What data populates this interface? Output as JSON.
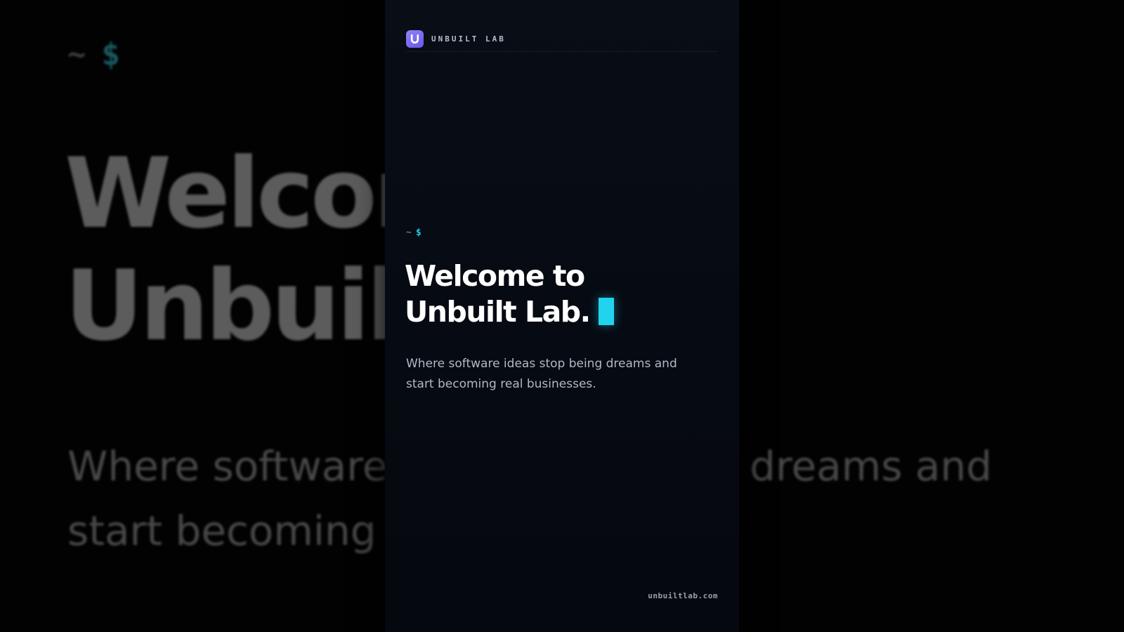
{
  "brand": {
    "name": "UNBUILT LAB",
    "logo_letter": "U",
    "logo_icon": "unbuilt-lab-logo-icon",
    "accent_color": "#7a6cf5"
  },
  "prompt": {
    "tilde": "~",
    "dollar": "$"
  },
  "hero": {
    "headline_line1": "Welcome to",
    "headline_line2": "Unbuilt Lab.",
    "cursor_color": "#22d3ee",
    "subtitle_line1": "Where software ideas stop being dreams and",
    "subtitle_line2": "start becoming real businesses."
  },
  "footer": {
    "url": "unbuiltlab.com"
  }
}
